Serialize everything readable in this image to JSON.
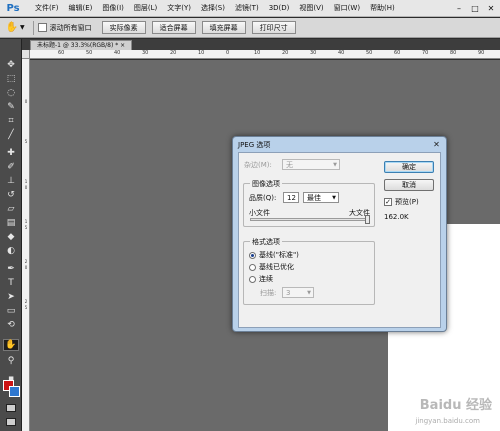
{
  "app": {
    "logo": "Ps"
  },
  "menu": [
    "文件(F)",
    "编辑(E)",
    "图像(I)",
    "图层(L)",
    "文字(Y)",
    "选择(S)",
    "滤镜(T)",
    "3D(D)",
    "视图(V)",
    "窗口(W)",
    "帮助(H)"
  ],
  "window_controls": {
    "minimize": "–",
    "maximize": "□",
    "close": "✕"
  },
  "options_bar": {
    "scroll_all_windows": "滚动所有窗口",
    "buttons": [
      "实际像素",
      "适合屏幕",
      "填充屏幕",
      "打印尺寸"
    ]
  },
  "document_tab": "未标题-1 @ 33.3%(RGB/8) * ×",
  "ruler_ticks": [
    "60",
    "50",
    "40",
    "30",
    "20",
    "10",
    "0",
    "10",
    "20",
    "30",
    "40",
    "50",
    "60",
    "70",
    "80",
    "90"
  ],
  "ruler_left_ticks": [
    "0",
    "5",
    "1",
    "0",
    "1",
    "5",
    "2",
    "0",
    "2",
    "5"
  ],
  "dialog": {
    "title": "JPEG 选项",
    "close": "✕",
    "matte_label": "杂边(M):",
    "matte_value": "无",
    "image_options_title": "图像选项",
    "quality_label": "品质(Q):",
    "quality_value": "12",
    "quality_preset": "最佳",
    "small_file": "小文件",
    "large_file": "大文件",
    "quality_slider_fraction": 1.0,
    "format_options_title": "格式选项",
    "format_options": [
      {
        "label": "基线(\"标准\")",
        "selected": true
      },
      {
        "label": "基线已优化",
        "selected": false
      },
      {
        "label": "连续",
        "selected": false
      }
    ],
    "scans_label": "扫描:",
    "scans_value": "3",
    "ok": "确定",
    "cancel": "取消",
    "preview_label": "预览(P)",
    "preview_checked": true,
    "file_size": "162.0K"
  },
  "watermark": {
    "text": "Baidu 经验",
    "url": "jingyan.baidu.com"
  },
  "colors": {
    "foreground": "#cc1414",
    "background": "#2f77cf",
    "canvas_gray": "#6a6a6a"
  }
}
